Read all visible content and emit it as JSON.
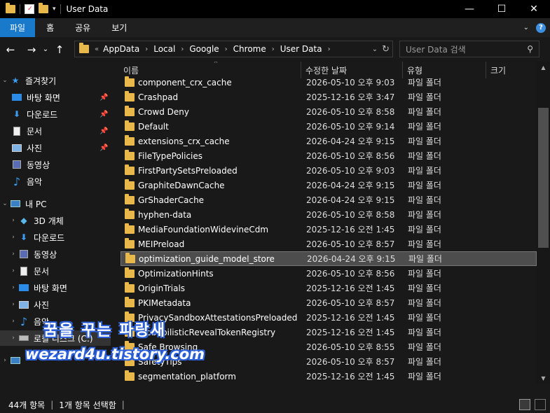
{
  "window": {
    "title": "User Data"
  },
  "ribbon": {
    "tabs": [
      "파일",
      "홈",
      "공유",
      "보기"
    ]
  },
  "address": {
    "prefix": "«",
    "crumbs": [
      "AppData",
      "Local",
      "Google",
      "Chrome",
      "User Data"
    ]
  },
  "search": {
    "placeholder": "User Data 검색"
  },
  "nav": {
    "quick_access": "즐겨찾기",
    "quick_items": [
      "바탕 화면",
      "다운로드",
      "문서",
      "사진",
      "동영상",
      "음악"
    ],
    "this_pc": "내 PC",
    "pc_items": [
      "3D 개체",
      "다운로드",
      "동영상",
      "문서",
      "바탕 화면",
      "사진",
      "음악",
      "로컬 디스크 (C:)"
    ]
  },
  "columns": {
    "name": "이름",
    "date": "수정한 날짜",
    "type": "유형",
    "size": "크기"
  },
  "files": [
    {
      "name": "component_crx_cache",
      "date": "2026-05-10 오후 9:03",
      "type": "파일 폴더"
    },
    {
      "name": "Crashpad",
      "date": "2025-12-16 오후 3:47",
      "type": "파일 폴더"
    },
    {
      "name": "Crowd Deny",
      "date": "2026-05-10 오후 8:58",
      "type": "파일 폴더"
    },
    {
      "name": "Default",
      "date": "2026-05-10 오후 9:14",
      "type": "파일 폴더"
    },
    {
      "name": "extensions_crx_cache",
      "date": "2026-04-24 오후 9:15",
      "type": "파일 폴더"
    },
    {
      "name": "FileTypePolicies",
      "date": "2026-05-10 오후 8:56",
      "type": "파일 폴더"
    },
    {
      "name": "FirstPartySetsPreloaded",
      "date": "2026-05-10 오후 9:03",
      "type": "파일 폴더"
    },
    {
      "name": "GraphiteDawnCache",
      "date": "2026-04-24 오후 9:15",
      "type": "파일 폴더"
    },
    {
      "name": "GrShaderCache",
      "date": "2026-04-24 오후 9:15",
      "type": "파일 폴더"
    },
    {
      "name": "hyphen-data",
      "date": "2026-05-10 오후 8:58",
      "type": "파일 폴더"
    },
    {
      "name": "MediaFoundationWidevineCdm",
      "date": "2025-12-16 오전 1:45",
      "type": "파일 폴더"
    },
    {
      "name": "MEIPreload",
      "date": "2026-05-10 오후 8:57",
      "type": "파일 폴더"
    },
    {
      "name": "optimization_guide_model_store",
      "date": "2026-04-24 오후 9:15",
      "type": "파일 폴더"
    },
    {
      "name": "OptimizationHints",
      "date": "2026-05-10 오후 8:56",
      "type": "파일 폴더"
    },
    {
      "name": "OriginTrials",
      "date": "2025-12-16 오전 1:45",
      "type": "파일 폴더"
    },
    {
      "name": "PKIMetadata",
      "date": "2026-05-10 오후 8:57",
      "type": "파일 폴더"
    },
    {
      "name": "PrivacySandboxAttestationsPreloaded",
      "date": "2025-12-16 오전 1:45",
      "type": "파일 폴더"
    },
    {
      "name": "ProbabilisticRevealTokenRegistry",
      "date": "2025-12-16 오전 1:45",
      "type": "파일 폴더"
    },
    {
      "name": "Safe Browsing",
      "date": "2026-05-10 오후 8:55",
      "type": "파일 폴더"
    },
    {
      "name": "SafetyTips",
      "date": "2026-05-10 오후 8:57",
      "type": "파일 폴더"
    },
    {
      "name": "segmentation_platform",
      "date": "2025-12-16 오전 1:45",
      "type": "파일 폴더"
    }
  ],
  "selected_index": 12,
  "status": {
    "count": "44개 항목",
    "selected": "1개 항목 선택함"
  },
  "watermark": {
    "line1": "꿈을 꾸는 파랑새",
    "line2": "wezard4u.tistory.com"
  },
  "colors": {
    "accent": "#1979ca",
    "folder": "#e8b84a",
    "selection": "#4d4d4d"
  }
}
